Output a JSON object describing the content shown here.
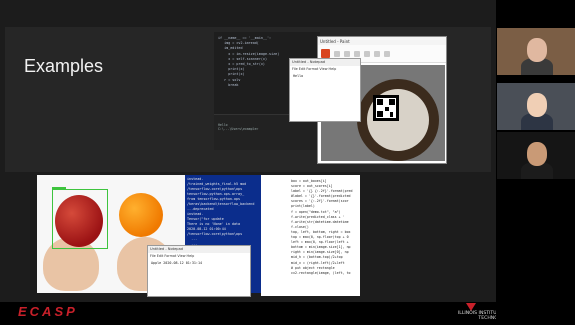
{
  "slide": {
    "title": "Examples",
    "footer_brand": "ECASP",
    "footer_institution": "ILLINOIS INSTITUTE OF TECHNOLOGY"
  },
  "editor": {
    "code_lines": [
      "if __name__ == '__main__':",
      "   img = cv2.imread(",
      "",
      "   im_edited",
      "     x = im.resize(image.size)",
      "     x = self.scanner(x)",
      "     x = pred_to_str(x)",
      "     print(x)",
      "     print(x)",
      "   r = solv",
      "     break"
    ],
    "terminal_lines": [
      "Hello",
      "C:\\...\\Users\\example>"
    ]
  },
  "paint": {
    "title": "Untitled - Paint"
  },
  "notepad_top": {
    "title": "Untitled - Notepad",
    "menu": "File  Edit  Format  View  Help",
    "text": "Hello"
  },
  "terminal_bottom": {
    "lines": [
      "instead.",
      "",
      "/trained_weights_final.h5 mod",
      "/tensorflow-core\\python\\ops",
      "tensorflow.python.ops.array_",
      "from tensorflow.python.ops",
      "/keras\\backend\\tensorflow_backend",
      "",
      "...deprecated",
      "instead.",
      "",
      "Tensor(\"for update",
      "There is no 'None' in data",
      "2020-08-12 01:00:44",
      "/tensorflow-core\\python\\ops",
      "  ...",
      "  ...",
      "fp.fps...",
      "  fp\\fps.cpp"
    ]
  },
  "notepad_bottom": {
    "title": "Untitled - Notepad",
    "menu": "File  Edit  Format  View  Help",
    "text": "Apple 2020-08-12 01:31:14"
  },
  "codepage": {
    "lines": [
      "box = out_boxes[i]",
      "score = out_scores[i]",
      "",
      "label = '{} {:.2f}'.format(pred",
      "#label = '{}'.format(predicted",
      "scores = '{:.2f}'.format(scor",
      "print(label)",
      "f = open(\"demo.txt\", \"a\")",
      "f.write(predicted_class + '",
      "f.write(str(datetime.datetime",
      "f.close()",
      "",
      "top, left, bottom, right = box",
      "top = max(0, np.floor(top + 0",
      "left = max(0, np.floor(left +",
      "bottom = min(image.size[1], np",
      "right = min(image.size[0], np",
      "",
      "mid_h = (bottom-top)/2+top",
      "mid_v = (right-left)/2+left",
      "",
      "# put object rectangle",
      "cv2.rectangle(image, (left, to"
    ]
  },
  "participants": [
    {
      "bg": "#7b5e45",
      "face": "#e0b8a0",
      "body": "#3a3a3a"
    },
    {
      "bg": "#4a4f57",
      "face": "#f0cfb5",
      "body": "#2d3544"
    },
    {
      "bg": "#151515",
      "face": "#c99a76",
      "body": "#1c1c1c"
    }
  ],
  "colors": {
    "brand_red": "#c8202a",
    "slide_bg": "#1c1c1c",
    "terminal_blue": "#0b2d8c",
    "bbox_green": "#3ec43e"
  }
}
